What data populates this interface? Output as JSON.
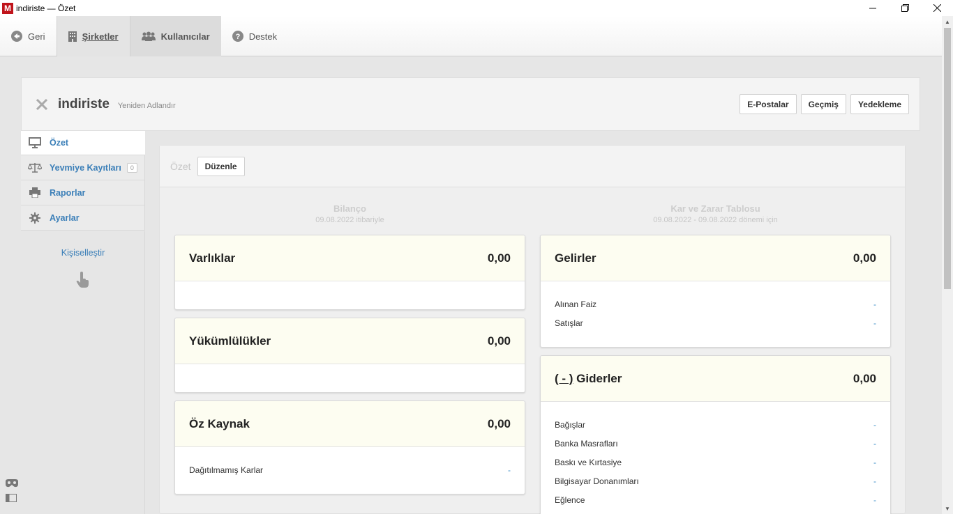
{
  "window": {
    "title": "indiriste — Özet",
    "app_letter": "M"
  },
  "toolbar": {
    "back": "Geri",
    "companies": "Şirketler",
    "users": "Kullanıcılar",
    "support": "Destek"
  },
  "company": {
    "name": "indiriste",
    "rename": "Yeniden Adlandır",
    "buttons": {
      "emails": "E-Postalar",
      "history": "Geçmiş",
      "backup": "Yedekleme"
    }
  },
  "sidebar": {
    "items": [
      {
        "label": "Özet",
        "icon": "presentation-icon"
      },
      {
        "label": "Yevmiye Kayıtları",
        "icon": "scale-icon",
        "badge": "0"
      },
      {
        "label": "Raporlar",
        "icon": "printer-icon"
      },
      {
        "label": "Ayarlar",
        "icon": "gear-icon"
      }
    ],
    "customize": "Kişiselleştir"
  },
  "panel": {
    "title": "Özet",
    "edit": "Düzenle"
  },
  "balance": {
    "title": "Bilanço",
    "subtitle": "09.08.2022 itibariyle",
    "assets": {
      "name": "Varlıklar",
      "value": "0,00"
    },
    "liabilities": {
      "name": "Yükümlülükler",
      "value": "0,00"
    },
    "equity": {
      "name": "Öz Kaynak",
      "value": "0,00",
      "rows": [
        {
          "label": "Dağıtılmamış Karlar",
          "value": "-"
        }
      ]
    }
  },
  "pnl": {
    "title": "Kar ve Zarar Tablosu",
    "subtitle": "09.08.2022 - 09.08.2022 dönemi için",
    "income": {
      "name": "Gelirler",
      "value": "0,00",
      "rows": [
        {
          "label": "Alınan Faiz",
          "value": "-"
        },
        {
          "label": "Satışlar",
          "value": "-"
        }
      ]
    },
    "expenses": {
      "prefix": "( - )",
      "name": "Giderler",
      "value": "0,00",
      "rows": [
        {
          "label": "Bağışlar",
          "value": "-"
        },
        {
          "label": "Banka Masrafları",
          "value": "-"
        },
        {
          "label": "Baskı ve Kırtasiye",
          "value": "-"
        },
        {
          "label": "Bilgisayar Donanımları",
          "value": "-"
        },
        {
          "label": "Eğlence",
          "value": "-"
        }
      ]
    }
  },
  "colors": {
    "accent": "#3b7fb8",
    "brand": "#c0141b",
    "card_head": "#fdfdf1"
  }
}
